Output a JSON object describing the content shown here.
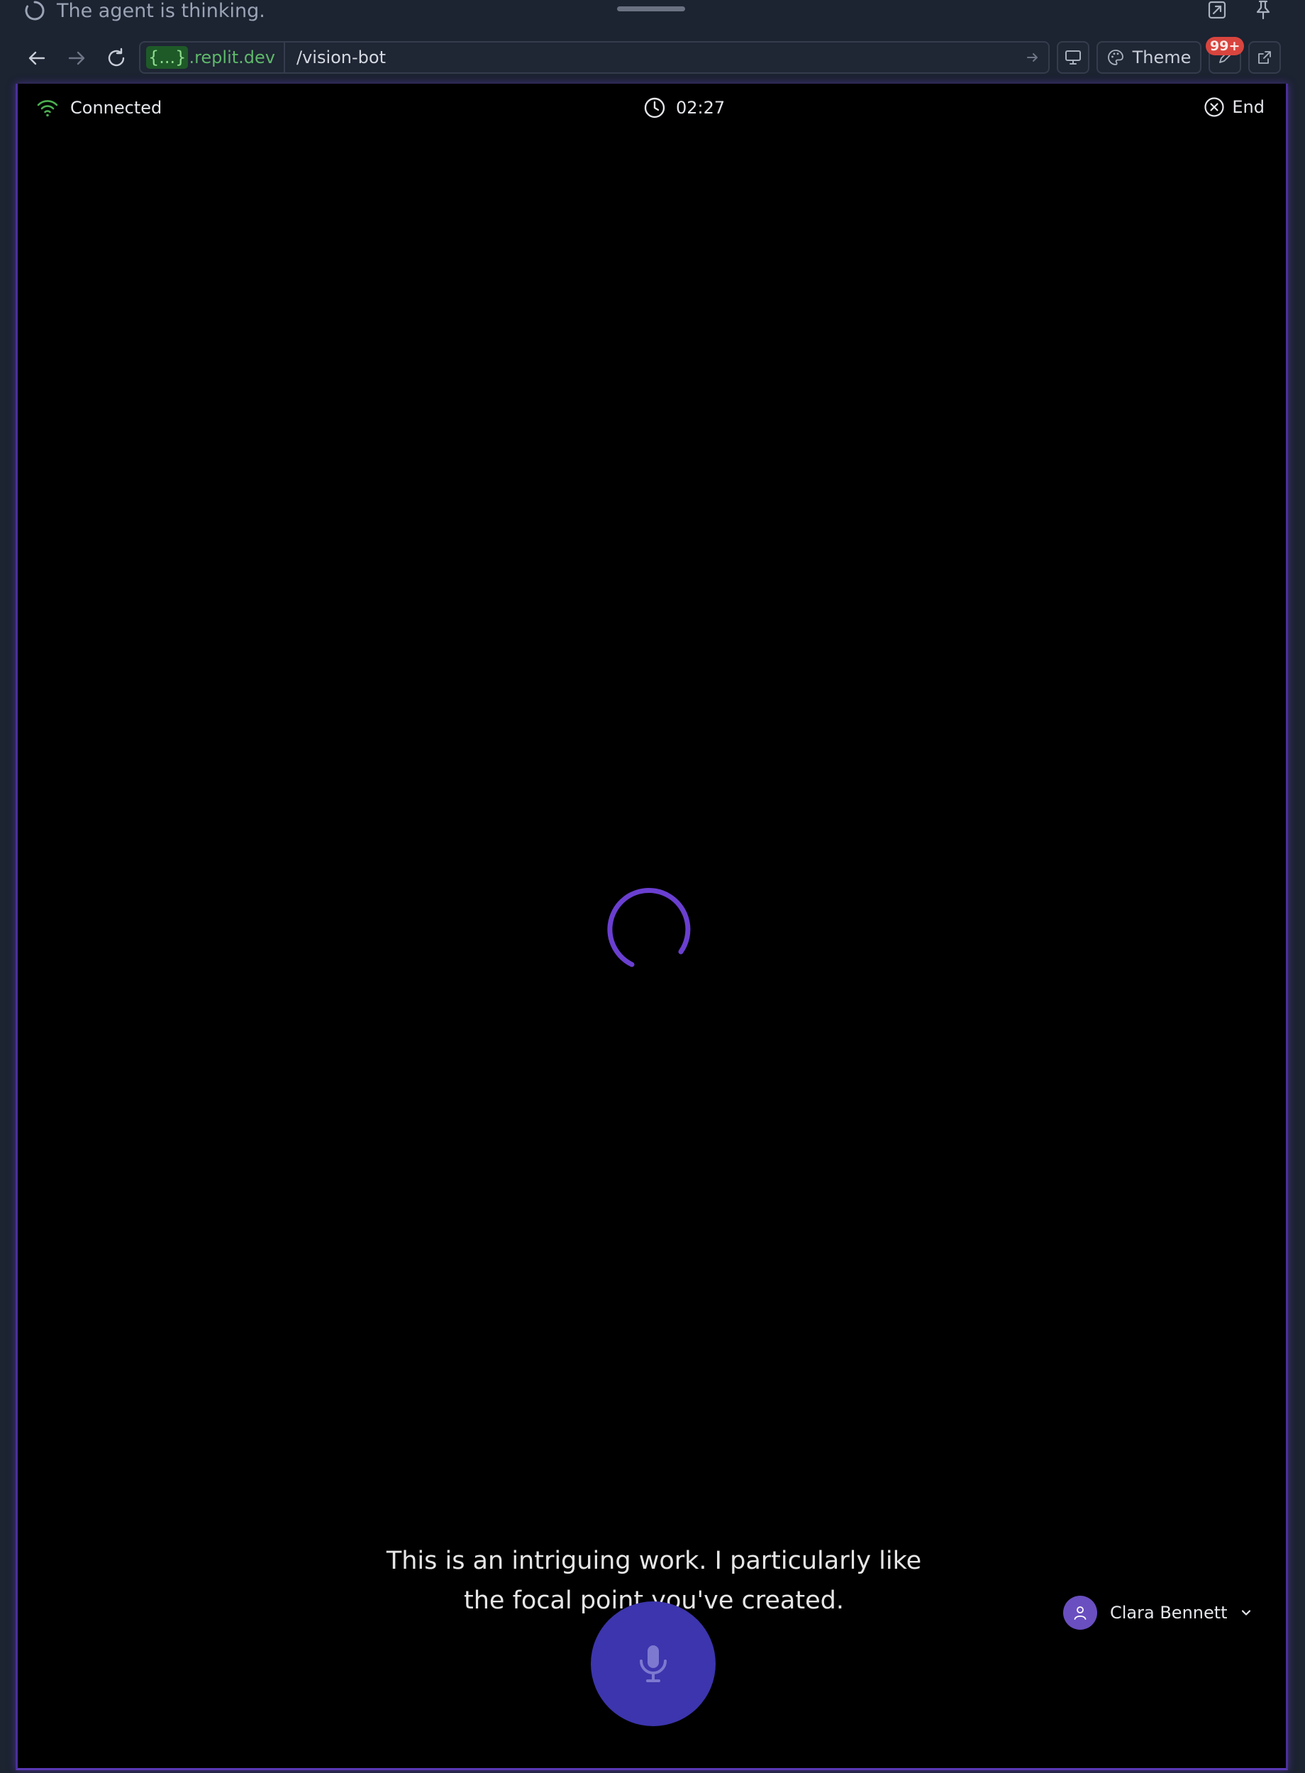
{
  "agent_status": {
    "text": "The agent is thinking."
  },
  "browser": {
    "url_host_prefix": "{...}",
    "url_host_domain": ".replit.dev",
    "url_path": "/vision-bot",
    "theme_label": "Theme",
    "badge_count": "99+"
  },
  "call": {
    "connection_status": "Connected",
    "elapsed_time": "02:27",
    "end_label": "End",
    "transcript": "This is an intriguing work. I particularly like the focal point you've created.",
    "user_name": "Clara Bennett"
  },
  "colors": {
    "accent": "#6a3fd0",
    "connected": "#4caf50",
    "mic_button": "#3c35ad",
    "badge": "#d8453e"
  },
  "icons": {
    "status": "spinner-icon",
    "connection": "wifi-icon",
    "timer": "clock-icon",
    "end": "close-circle-icon",
    "mic": "microphone-icon",
    "avatar": "user-icon"
  }
}
